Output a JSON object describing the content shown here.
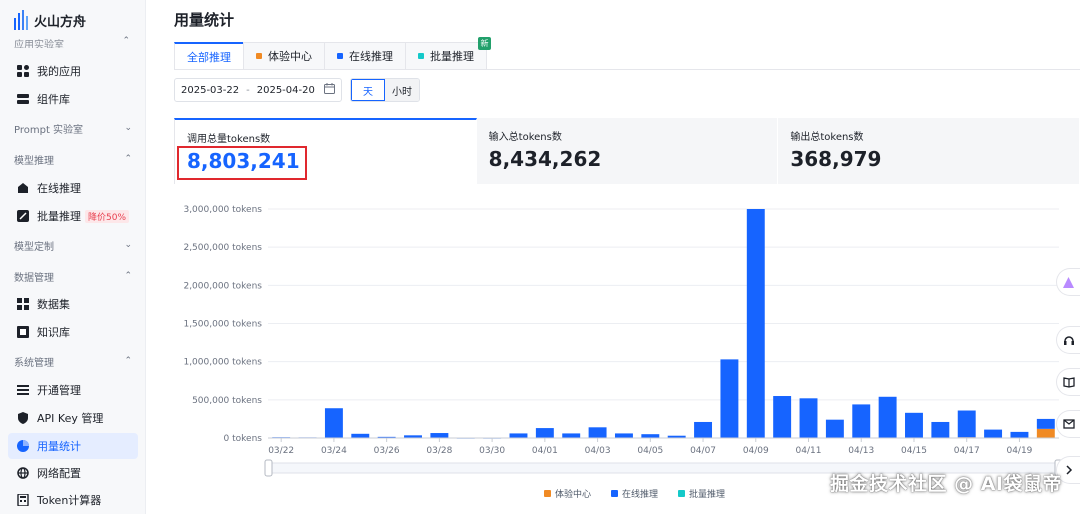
{
  "brand": {
    "name": "火山方舟"
  },
  "sidebar": {
    "cut_label": "应用实验室",
    "items": [
      {
        "label": "我的应用",
        "icon": "apps-icon"
      },
      {
        "label": "组件库",
        "icon": "component-icon"
      },
      {
        "label": "Prompt 实验室",
        "type": "group"
      },
      {
        "label": "模型推理",
        "type": "group"
      },
      {
        "label": "在线推理",
        "icon": "online-inference-icon"
      },
      {
        "label": "批量推理",
        "icon": "batch-inference-icon",
        "badge": "降价50%"
      },
      {
        "label": "模型定制",
        "type": "group"
      },
      {
        "label": "数据管理",
        "type": "group"
      },
      {
        "label": "数据集",
        "icon": "dataset-icon"
      },
      {
        "label": "知识库",
        "icon": "knowledge-icon"
      },
      {
        "label": "系统管理",
        "type": "group"
      },
      {
        "label": "开通管理",
        "icon": "activation-icon"
      },
      {
        "label": "API Key 管理",
        "icon": "shield-icon"
      },
      {
        "label": "用量统计",
        "icon": "usage-icon",
        "active": true
      },
      {
        "label": "网络配置",
        "icon": "network-icon"
      },
      {
        "label": "Token计算器",
        "icon": "calculator-icon"
      }
    ]
  },
  "page": {
    "title": "用量统计"
  },
  "tabs": [
    {
      "label": "全部推理",
      "active": true
    },
    {
      "label": "体验中心",
      "color": "#f08a24"
    },
    {
      "label": "在线推理",
      "color": "#1664ff"
    },
    {
      "label": "批量推理",
      "color": "#14c9c9",
      "badge": "新"
    }
  ],
  "filters": {
    "start_date": "2025-03-22",
    "separator": "-",
    "end_date": "2025-04-20",
    "granularity": [
      {
        "label": "天",
        "active": true
      },
      {
        "label": "小时"
      }
    ]
  },
  "stats": [
    {
      "label": "调用总量tokens数",
      "value": "8,803,241",
      "active": true
    },
    {
      "label": "输入总tokens数",
      "value": "8,434,262"
    },
    {
      "label": "输出总tokens数",
      "value": "368,979"
    }
  ],
  "chart_data": {
    "type": "bar",
    "stacked": true,
    "ylim": [
      0,
      3000000
    ],
    "y_ticks": [
      {
        "value": 0,
        "label": "0 tokens"
      },
      {
        "value": 500000,
        "label": "500,000 tokens"
      },
      {
        "value": 1000000,
        "label": "1,000,000 tokens"
      },
      {
        "value": 1500000,
        "label": "1,500,000 tokens"
      },
      {
        "value": 2000000,
        "label": "2,000,000 tokens"
      },
      {
        "value": 2500000,
        "label": "2,500,000 tokens"
      },
      {
        "value": 3000000,
        "label": "3,000,000 tokens"
      }
    ],
    "categories": [
      "03/22",
      "03/23",
      "03/24",
      "03/25",
      "03/26",
      "03/27",
      "03/28",
      "03/29",
      "03/30",
      "03/31",
      "04/01",
      "04/02",
      "04/03",
      "04/04",
      "04/05",
      "04/06",
      "04/07",
      "04/08",
      "04/09",
      "04/10",
      "04/11",
      "04/12",
      "04/13",
      "04/14",
      "04/15",
      "04/16",
      "04/17",
      "04/18",
      "04/19",
      "04/20"
    ],
    "x_tick_labels": [
      "03/22",
      "03/24",
      "03/26",
      "03/28",
      "03/30",
      "04/01",
      "04/03",
      "04/05",
      "04/07",
      "04/09",
      "04/11",
      "04/13",
      "04/15",
      "04/17",
      "04/19"
    ],
    "series": [
      {
        "name": "体验中心",
        "color": "#f08a24",
        "values": [
          0,
          0,
          0,
          0,
          0,
          0,
          0,
          0,
          0,
          0,
          0,
          0,
          0,
          0,
          0,
          0,
          0,
          0,
          0,
          0,
          0,
          0,
          0,
          0,
          0,
          0,
          10000,
          0,
          0,
          120000
        ]
      },
      {
        "name": "在线推理",
        "color": "#1664ff",
        "values": [
          10000,
          8000,
          390000,
          55000,
          15000,
          35000,
          65000,
          5000,
          5000,
          60000,
          130000,
          60000,
          140000,
          60000,
          50000,
          30000,
          210000,
          1030000,
          3000000,
          550000,
          520000,
          240000,
          440000,
          540000,
          330000,
          210000,
          350000,
          110000,
          80000,
          130000
        ]
      },
      {
        "name": "批量推理",
        "color": "#14c9c9",
        "values": [
          0,
          0,
          0,
          0,
          0,
          0,
          0,
          0,
          0,
          0,
          0,
          0,
          0,
          0,
          0,
          0,
          0,
          0,
          0,
          0,
          0,
          0,
          0,
          0,
          0,
          0,
          0,
          0,
          0,
          0
        ]
      }
    ],
    "legend_position": "bottom"
  },
  "watermark": "掘金技术社区 @ AI袋鼠帝"
}
